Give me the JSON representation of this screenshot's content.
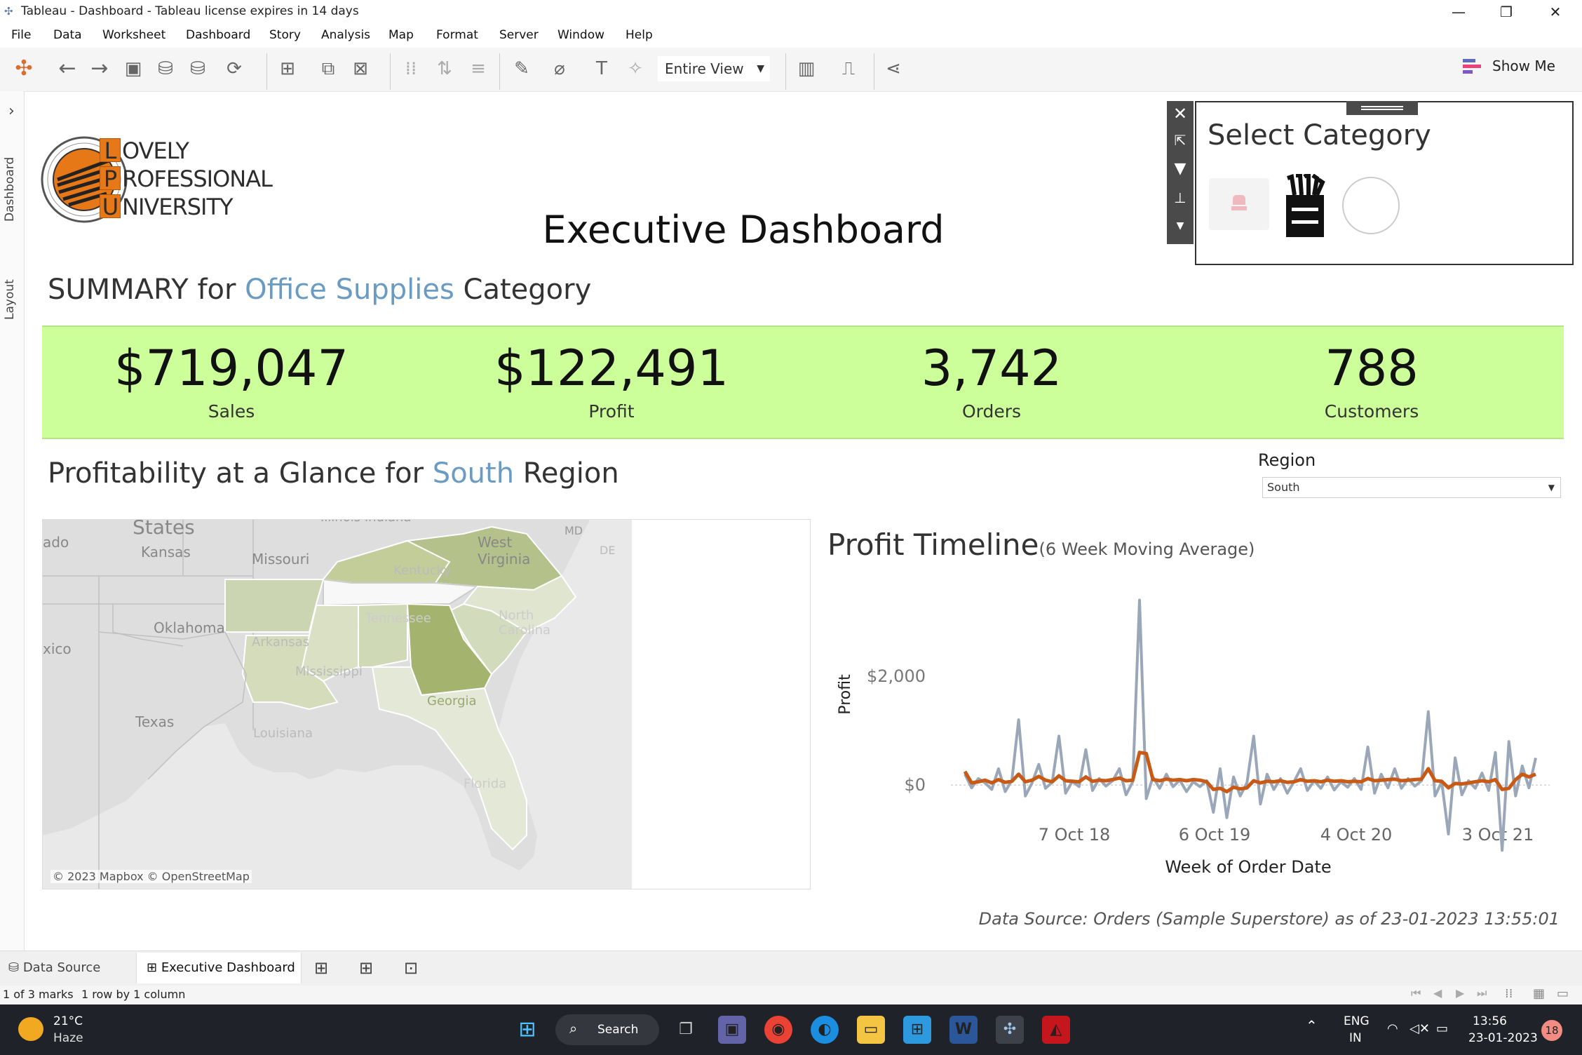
{
  "window": {
    "title": "Tableau - Dashboard - Tableau license expires in 14 days"
  },
  "menu": [
    "File",
    "Data",
    "Worksheet",
    "Dashboard",
    "Story",
    "Analysis",
    "Map",
    "Format",
    "Server",
    "Window",
    "Help"
  ],
  "toolbar": {
    "view_select": "Entire View",
    "show_me": "Show Me"
  },
  "side_tabs": {
    "dashboard": "Dashboard",
    "layout": "Layout"
  },
  "logo": {
    "line1": "OVELY",
    "line2": "ROFESSIONAL",
    "line3": "NIVERSITY",
    "l1": "L",
    "l2": "P",
    "l3": "U"
  },
  "dashboard": {
    "title": "Executive Dashboard",
    "summary_prefix": "SUMMARY for",
    "summary_category": "Office Supplies",
    "summary_suffix": "Category",
    "kpis": [
      {
        "value": "$719,047",
        "label": "Sales"
      },
      {
        "value": "$122,491",
        "label": "Profit"
      },
      {
        "value": "3,742",
        "label": "Orders"
      },
      {
        "value": "788",
        "label": "Customers"
      }
    ],
    "profit_head_prefix": "Profitability at a Glance for",
    "profit_head_region": "South",
    "profit_head_suffix": "Region",
    "region_label": "Region",
    "region_value": "South",
    "map_credit": "© 2023 Mapbox © OpenStreetMap",
    "map_labels": [
      "States",
      "Kansas",
      "Missouri",
      "Oklahoma",
      "Texas",
      "Arkansas",
      "Mississippi",
      "Louisiana",
      "Tennessee",
      "Kentucky",
      "West Virginia",
      "North Carolina",
      "Georgia",
      "Florida",
      "MD",
      "DE",
      "ado",
      "xico",
      "Illinois  Indiana"
    ],
    "chart_title": "Profit Timeline",
    "chart_subtitle": "(6 Week Moving Average)",
    "data_source": "Data Source: Orders (Sample  Superstore) as of 23-01-2023 13:55:01"
  },
  "category_panel": {
    "title": "Select Category"
  },
  "chart_data": {
    "type": "line",
    "title": "Profit Timeline",
    "subtitle": "(6 Week Moving Average)",
    "xlabel": "Week of Order Date",
    "ylabel": "Profit",
    "x_ticks": [
      "7 Oct 18",
      "6 Oct 19",
      "4 Oct 20",
      "3 Oct 21"
    ],
    "y_ticks": [
      "$2,000",
      "$0"
    ],
    "ylim": [
      -1300,
      3600
    ],
    "series": [
      {
        "color": "#9aa7b8",
        "values": [
          200,
          -50,
          120,
          40,
          -80,
          300,
          -120,
          90,
          1200,
          -200,
          40,
          380,
          -60,
          50,
          900,
          -150,
          70,
          -30,
          650,
          -100,
          120,
          -20,
          80,
          300,
          -180,
          60,
          3400,
          -250,
          150,
          -60,
          200,
          -30,
          90,
          -120,
          60,
          -30,
          80,
          -500,
          300,
          -600,
          150,
          -200,
          40,
          900,
          -350,
          200,
          -80,
          120,
          -150,
          60,
          300,
          -100,
          80,
          -60,
          150,
          -90,
          60,
          -40,
          120,
          -80,
          700,
          -150,
          200,
          -50,
          300,
          -60,
          120,
          -20,
          80,
          1350,
          -200,
          60,
          -900,
          500,
          -180,
          80,
          -60,
          220,
          -100,
          600,
          -1200,
          800,
          -200,
          350,
          -50,
          500
        ]
      },
      {
        "color": "#c85a16",
        "values": [
          250,
          40,
          60,
          90,
          40,
          100,
          50,
          70,
          200,
          60,
          90,
          160,
          90,
          60,
          170,
          80,
          70,
          60,
          150,
          70,
          90,
          80,
          100,
          130,
          80,
          90,
          600,
          580,
          100,
          80,
          110,
          90,
          100,
          80,
          100,
          90,
          60,
          -80,
          -60,
          -120,
          -40,
          -70,
          -50,
          80,
          40,
          70,
          60,
          80,
          50,
          60,
          100,
          70,
          80,
          60,
          90,
          70,
          80,
          60,
          70,
          60,
          120,
          80,
          90,
          100,
          110,
          80,
          90,
          100,
          110,
          300,
          80,
          70,
          -50,
          30,
          20,
          40,
          60,
          80,
          60,
          100,
          -80,
          -60,
          100,
          200,
          150,
          200
        ]
      }
    ]
  },
  "sheet_tabs": {
    "data_source": "Data Source",
    "active": "Executive Dashboard"
  },
  "status": {
    "marks": "1 of 3 marks",
    "rows": "1 row by 1 column"
  },
  "taskbar": {
    "weather_temp": "21°C",
    "weather_desc": "Haze",
    "search": "Search",
    "lang1": "ENG",
    "lang2": "IN",
    "time": "13:56",
    "date": "23-01-2023",
    "notif": "18"
  }
}
